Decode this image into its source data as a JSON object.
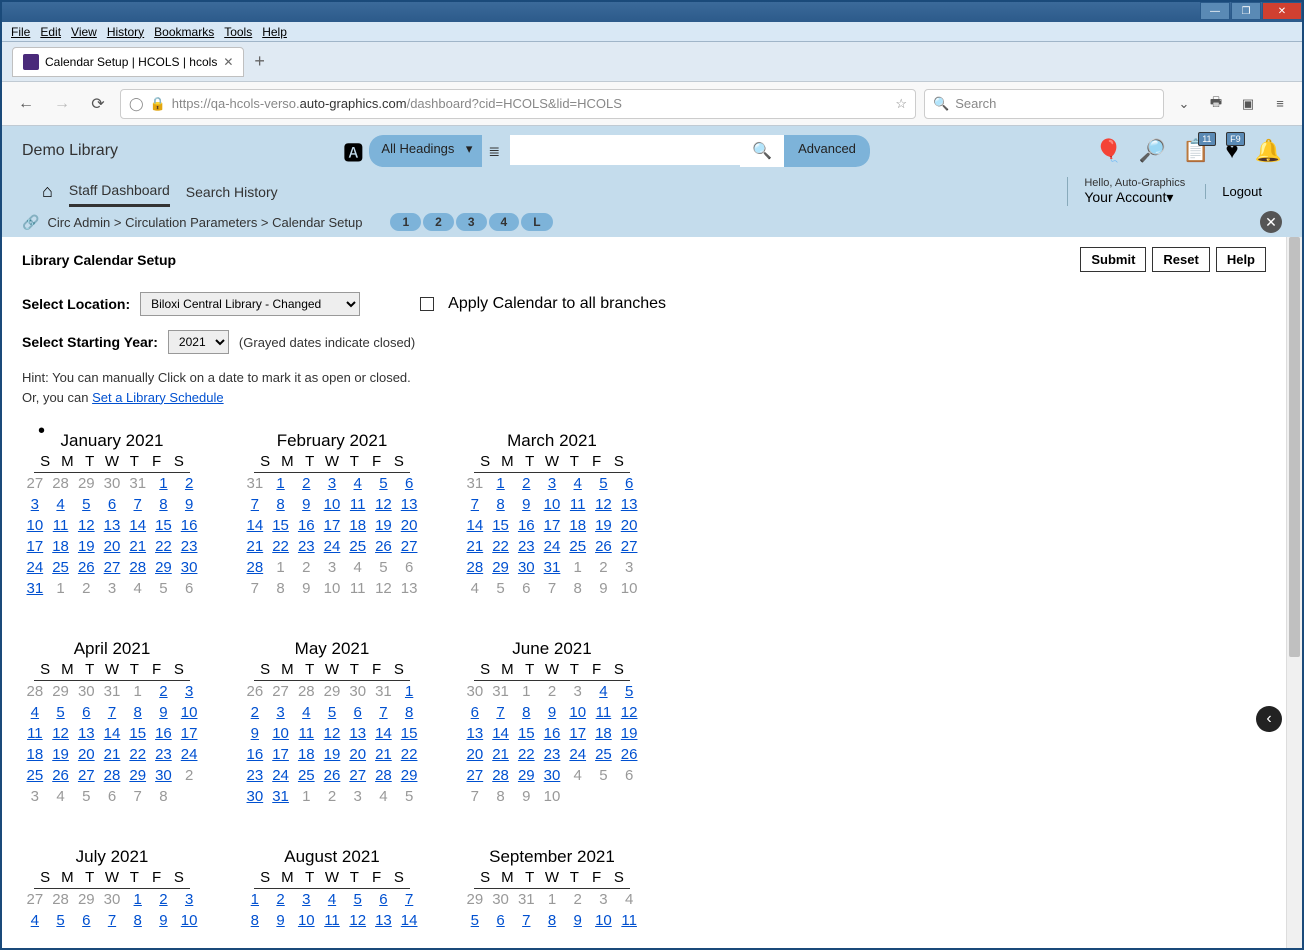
{
  "window": {
    "title_buttons": {
      "min": "—",
      "max": "❐",
      "close": "✕"
    }
  },
  "menu": [
    "File",
    "Edit",
    "View",
    "History",
    "Bookmarks",
    "Tools",
    "Help"
  ],
  "tab": {
    "title": "Calendar Setup | HCOLS | hcols"
  },
  "url": {
    "prefix": "https://qa-hcols-verso.",
    "domain": "auto-graphics.com",
    "path": "/dashboard?cid=HCOLS&lid=HCOLS"
  },
  "browser_search_placeholder": "Search",
  "app": {
    "library_name": "Demo Library",
    "headings": "All Headings",
    "advanced": "Advanced",
    "badges": {
      "list": "11",
      "heart": "F9"
    },
    "greeting": "Hello, Auto-Graphics",
    "account": "Your Account",
    "logout": "Logout",
    "nav": {
      "staff": "Staff Dashboard",
      "history": "Search History"
    }
  },
  "breadcrumb": {
    "parts": [
      "Circ Admin",
      "Circulation Parameters",
      "Calendar Setup"
    ],
    "pages": [
      "1",
      "2",
      "3",
      "4",
      "L"
    ]
  },
  "page": {
    "title": "Library Calendar Setup",
    "submit": "Submit",
    "reset": "Reset",
    "help": "Help",
    "location_label": "Select Location:",
    "location_value": "Biloxi Central Library - Changed",
    "apply_all": "Apply Calendar to all branches",
    "year_label": "Select Starting Year:",
    "year_value": "2021",
    "grayed_note": "(Grayed dates indicate closed)",
    "hint1": "Hint: You can manually Click on a date to mark it as open or closed.",
    "hint2_prefix": "Or, you can ",
    "hint2_link": "Set a Library Schedule"
  },
  "dow": [
    "S",
    "M",
    "T",
    "W",
    "T",
    "F",
    "S"
  ],
  "months": [
    {
      "title": "January 2021",
      "dot": true,
      "lead": [
        "27",
        "28",
        "29",
        "30",
        "31"
      ],
      "days": 31,
      "trail": [
        "1",
        "2",
        "3",
        "4",
        "5",
        "6"
      ],
      "closed": []
    },
    {
      "title": "February 2021",
      "lead": [
        "31"
      ],
      "days": 28,
      "trail": [
        "1",
        "2",
        "3",
        "4",
        "5",
        "6",
        "7",
        "8",
        "9",
        "10",
        "11",
        "12",
        "13"
      ],
      "closed": []
    },
    {
      "title": "March 2021",
      "lead": [
        "31"
      ],
      "days": 31,
      "trail": [
        "1",
        "2",
        "3",
        "4",
        "5",
        "6",
        "7",
        "8",
        "9",
        "10"
      ],
      "closed": []
    },
    {
      "title": "April 2021",
      "lead": [
        "28",
        "29",
        "30",
        "31"
      ],
      "days": 30,
      "trail": [
        "2",
        "3",
        "4",
        "5",
        "6",
        "7",
        "8"
      ],
      "closed": [
        1
      ]
    },
    {
      "title": "May 2021",
      "lead": [
        "26",
        "27",
        "28",
        "29",
        "30",
        "31"
      ],
      "days": 31,
      "trail": [
        "1",
        "2",
        "3",
        "4",
        "5"
      ],
      "closed": []
    },
    {
      "title": "June 2021",
      "lead": [
        "30",
        "31"
      ],
      "days": 30,
      "trail": [
        "4",
        "5",
        "6",
        "7",
        "8",
        "9",
        "10"
      ],
      "closed": [
        1,
        2,
        3
      ]
    },
    {
      "title": "July 2021",
      "lead": [
        "27",
        "28",
        "29",
        "30"
      ],
      "days": 31,
      "trail": [],
      "partial": 10,
      "closed": []
    },
    {
      "title": "August 2021",
      "lead": [],
      "days": 31,
      "trail": [],
      "partial": 14,
      "closed": []
    },
    {
      "title": "September 2021",
      "lead": [
        "29",
        "30",
        "31"
      ],
      "days": 30,
      "trail": [],
      "partial": 11,
      "closed": [
        1,
        2,
        3,
        4
      ]
    }
  ]
}
